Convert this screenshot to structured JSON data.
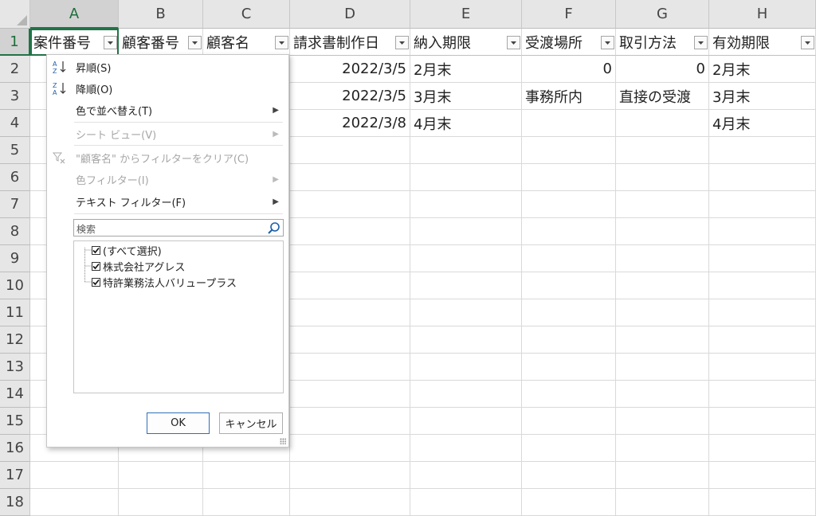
{
  "sheet": {
    "columns": [
      "A",
      "B",
      "C",
      "D",
      "E",
      "F",
      "G",
      "H"
    ],
    "rows": [
      "1",
      "2",
      "3",
      "4",
      "5",
      "6",
      "7",
      "8",
      "9",
      "10",
      "11",
      "12",
      "13",
      "14",
      "15",
      "16",
      "17",
      "18"
    ],
    "headers": [
      "案件番号",
      "顧客番号",
      "顧客名",
      "請求書制作日",
      "納入期限",
      "受渡場所",
      "取引方法",
      "有効期限"
    ],
    "data": [
      {
        "D": "2022/3/5",
        "E": "2月末",
        "F": "0",
        "G": "0",
        "H": "2月末"
      },
      {
        "D": "2022/3/5",
        "E": "3月末",
        "F": "事務所内",
        "G": "直接の受渡",
        "H": "3月末"
      },
      {
        "D": "2022/3/8",
        "E": "4月末",
        "F": "",
        "G": "",
        "H": "4月末"
      }
    ]
  },
  "filter_menu": {
    "sort_asc": "昇順(S)",
    "sort_desc": "降順(O)",
    "sort_by_color": "色で並べ替え(T)",
    "sheet_view": "シート ビュー(V)",
    "clear_filter": "\"顧客名\" からフィルターをクリア(C)",
    "color_filter": "色フィルター(I)",
    "text_filter": "テキスト フィルター(F)",
    "search_placeholder": "検索",
    "items": [
      "(すべて選択)",
      "株式会社アグレス",
      "特許業務法人バリュープラス"
    ],
    "ok": "OK",
    "cancel": "キャンセル"
  },
  "colors": {
    "header_bg": "#e6e6e6",
    "selection": "#217346",
    "ok_border": "#2f6fb7"
  }
}
